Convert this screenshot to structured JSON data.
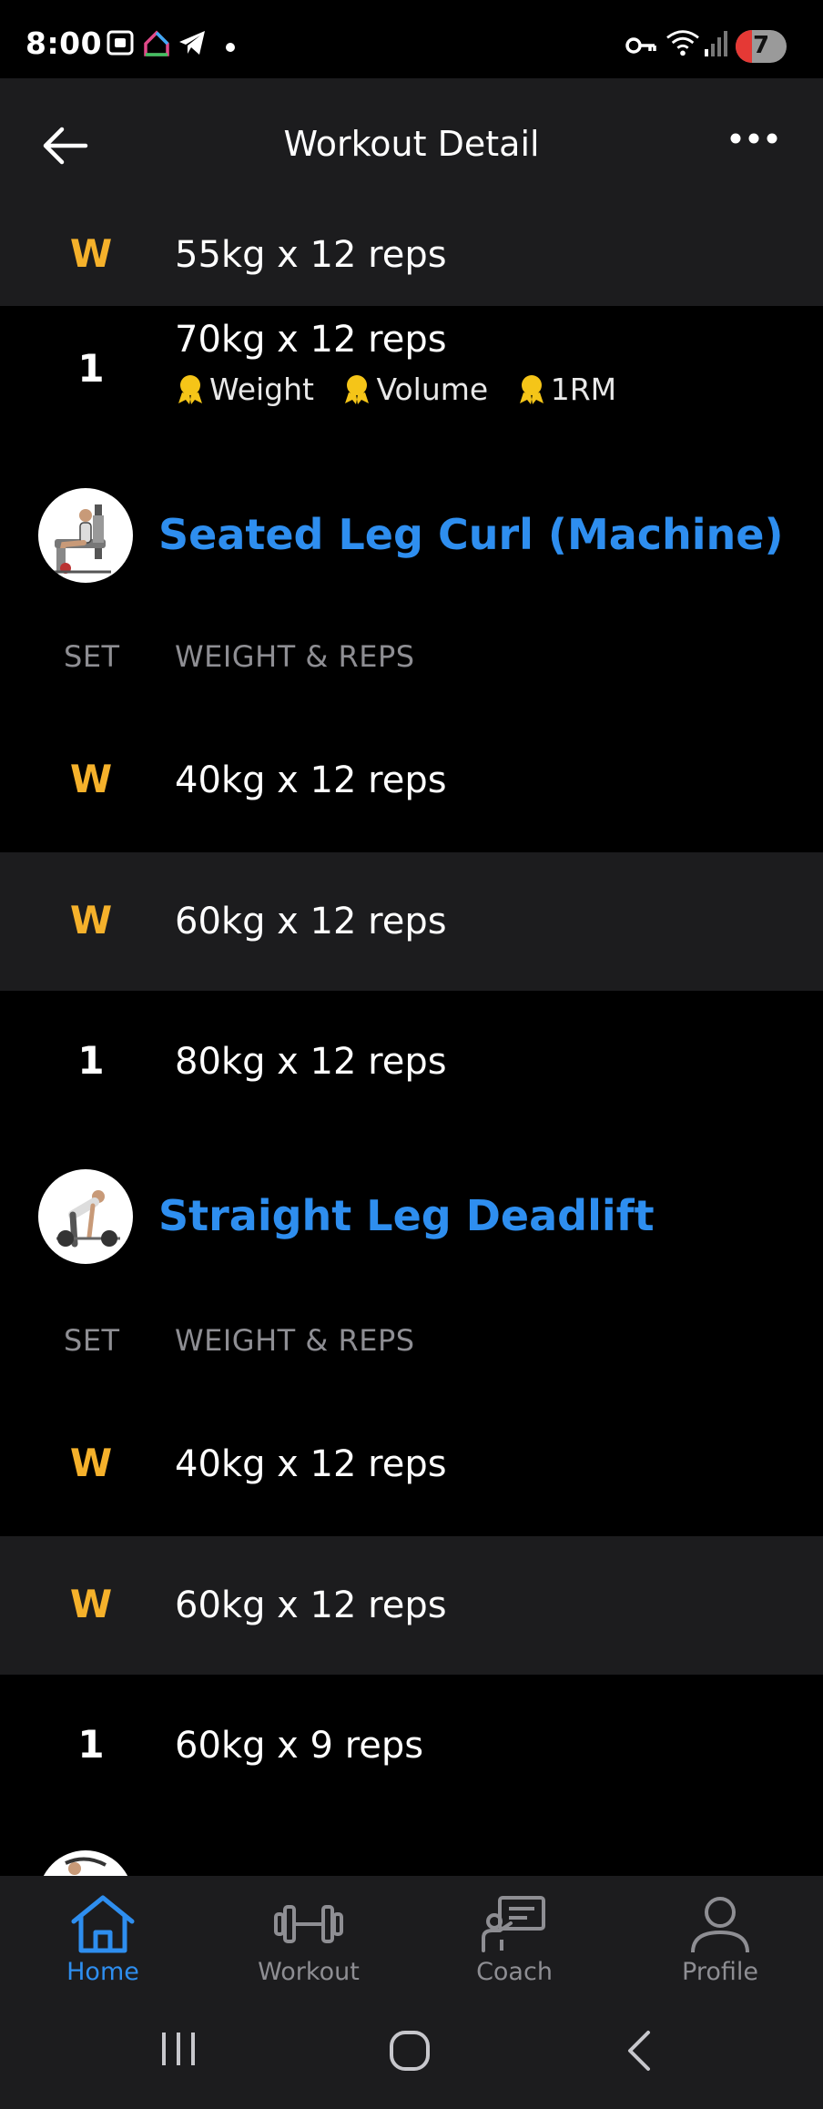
{
  "status_bar": {
    "time": "8:00",
    "battery_level": "7",
    "icons": [
      "screenshot-icon",
      "home-app-icon",
      "telegram-icon",
      "notification-dot-icon",
      "vpn-key-icon",
      "wifi-icon",
      "signal-icon",
      "battery-icon"
    ]
  },
  "header": {
    "title": "Workout Detail",
    "back_icon": "arrow-left-icon",
    "more_icon": "more-horizontal-icon"
  },
  "exercises": [
    {
      "sets": [
        {
          "label": "W",
          "type": "warmup",
          "text": "55kg x 12 reps"
        },
        {
          "label": "1",
          "type": "normal",
          "text": "70kg x 12 reps",
          "records": [
            "Weight",
            "Volume",
            "1RM"
          ]
        }
      ]
    },
    {
      "name": "Seated Leg Curl (Machine)",
      "col_set": "SET",
      "col_weight": "WEIGHT & REPS",
      "sets": [
        {
          "label": "W",
          "type": "warmup",
          "text": "40kg x 12 reps"
        },
        {
          "label": "W",
          "type": "warmup",
          "text": "60kg x 12 reps"
        },
        {
          "label": "1",
          "type": "normal",
          "text": "80kg x 12 reps"
        }
      ]
    },
    {
      "name": "Straight Leg Deadlift",
      "col_set": "SET",
      "col_weight": "WEIGHT & REPS",
      "sets": [
        {
          "label": "W",
          "type": "warmup",
          "text": "40kg x 12 reps"
        },
        {
          "label": "W",
          "type": "warmup",
          "text": "60kg x 12 reps"
        },
        {
          "label": "1",
          "type": "normal",
          "text": "60kg x 9 reps"
        }
      ]
    }
  ],
  "bottom_nav": {
    "items": [
      {
        "label": "Home",
        "icon": "home-icon",
        "active": true
      },
      {
        "label": "Workout",
        "icon": "dumbbell-icon",
        "active": false
      },
      {
        "label": "Coach",
        "icon": "coach-icon",
        "active": false
      },
      {
        "label": "Profile",
        "icon": "profile-icon",
        "active": false
      }
    ]
  },
  "system_nav": [
    "recent-apps-icon",
    "home-circle-icon",
    "back-chevron-icon"
  ],
  "colors": {
    "accent": "#2e8eef",
    "warmup": "#f5b12b",
    "row_shade": "#1c1c1e",
    "medal": "#f5c518"
  }
}
